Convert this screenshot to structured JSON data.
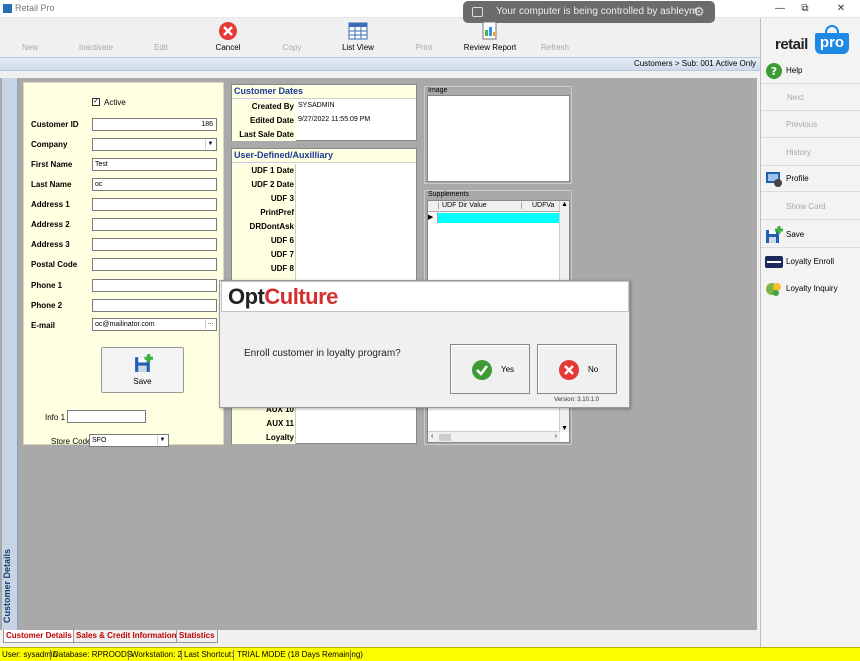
{
  "window": {
    "title": "Retail Pro",
    "minimize": "—",
    "restore": "⧉",
    "close": "✕"
  },
  "remote_banner": {
    "text": "Your computer is being controlled by ashleym"
  },
  "toolbar": {
    "new": "New",
    "inactivate": "Inactivate",
    "edit": "Edit",
    "cancel": "Cancel",
    "copy": "Copy",
    "list_view": "List View",
    "print": "Print",
    "review_report": "Review Report",
    "refresh": "Refresh"
  },
  "breadcrumb": "Customers > Sub: 001 Active Only",
  "side_tab": "Customer Details",
  "customer": {
    "active_label": "Active",
    "active_check": "✓",
    "customer_id_label": "Customer ID",
    "customer_id": "186",
    "company_label": "Company",
    "company": "",
    "first_name_label": "First Name",
    "first_name": "Test",
    "last_name_label": "Last Name",
    "last_name": "oc",
    "address1_label": "Address 1",
    "address1": "",
    "address2_label": "Address 2",
    "address2": "",
    "address3_label": "Address 3",
    "address3": "",
    "postal_code_label": "Postal Code",
    "postal_code": "",
    "phone1_label": "Phone 1",
    "phone1": "",
    "phone2_label": "Phone 2",
    "phone2": "",
    "email_label": "E-mail",
    "email": "oc@mailinator.com",
    "email_btn": "...",
    "save_label": "Save",
    "info1_label": "Info 1",
    "info1": "",
    "store_code_label": "Store Code",
    "store_code": "SFO"
  },
  "dates": {
    "header": "Customer Dates",
    "created_by_label": "Created By",
    "created_by": "SYSADMIN",
    "edited_date_label": "Edited Date",
    "edited_date": "9/27/2022 11:55:09 PM",
    "last_sale_label": "Last Sale Date",
    "last_sale": ""
  },
  "udf": {
    "header": "User-Defined/Auxilliary",
    "labels": [
      "UDF 1 Date",
      "UDF 2 Date",
      "UDF 3",
      "PrintPref",
      "DRDontAsk",
      "UDF 6",
      "UDF 7",
      "UDF 8"
    ],
    "aux10": "AUX 10",
    "aux11": "AUX 11",
    "loyalty": "Loyalty"
  },
  "image_group": {
    "title": "Image"
  },
  "supplements": {
    "title": "Supplements",
    "col1": "UDF Dir Value",
    "col2": "UDFVa"
  },
  "dialog": {
    "brand_opt": "Opt",
    "brand_culture": "Culture",
    "message": "Enroll customer in loyalty program?",
    "yes": "Yes",
    "no": "No",
    "version": "Version:  3.10.1.0"
  },
  "bottom_tabs": [
    "Customer Details",
    "Sales & Credit Information",
    "Statistics"
  ],
  "status": {
    "user": "User: sysadmin",
    "database": "Database: RPROODS",
    "workstation": "Workstation: 2",
    "last_shortcut": "Last Shortcut:",
    "trial": "TRIAL MODE (18 Days Remaining)"
  },
  "sidebar": {
    "logo_retail": "retail",
    "logo_pro": "pro",
    "help": "Help",
    "next": "Next",
    "previous": "Previous",
    "history": "History",
    "profile": "Profile",
    "show_card": "Show Card",
    "save": "Save",
    "loyalty_enroll": "Loyalty Enroll",
    "loyalty_inquiry": "Loyalty Inquiry"
  }
}
